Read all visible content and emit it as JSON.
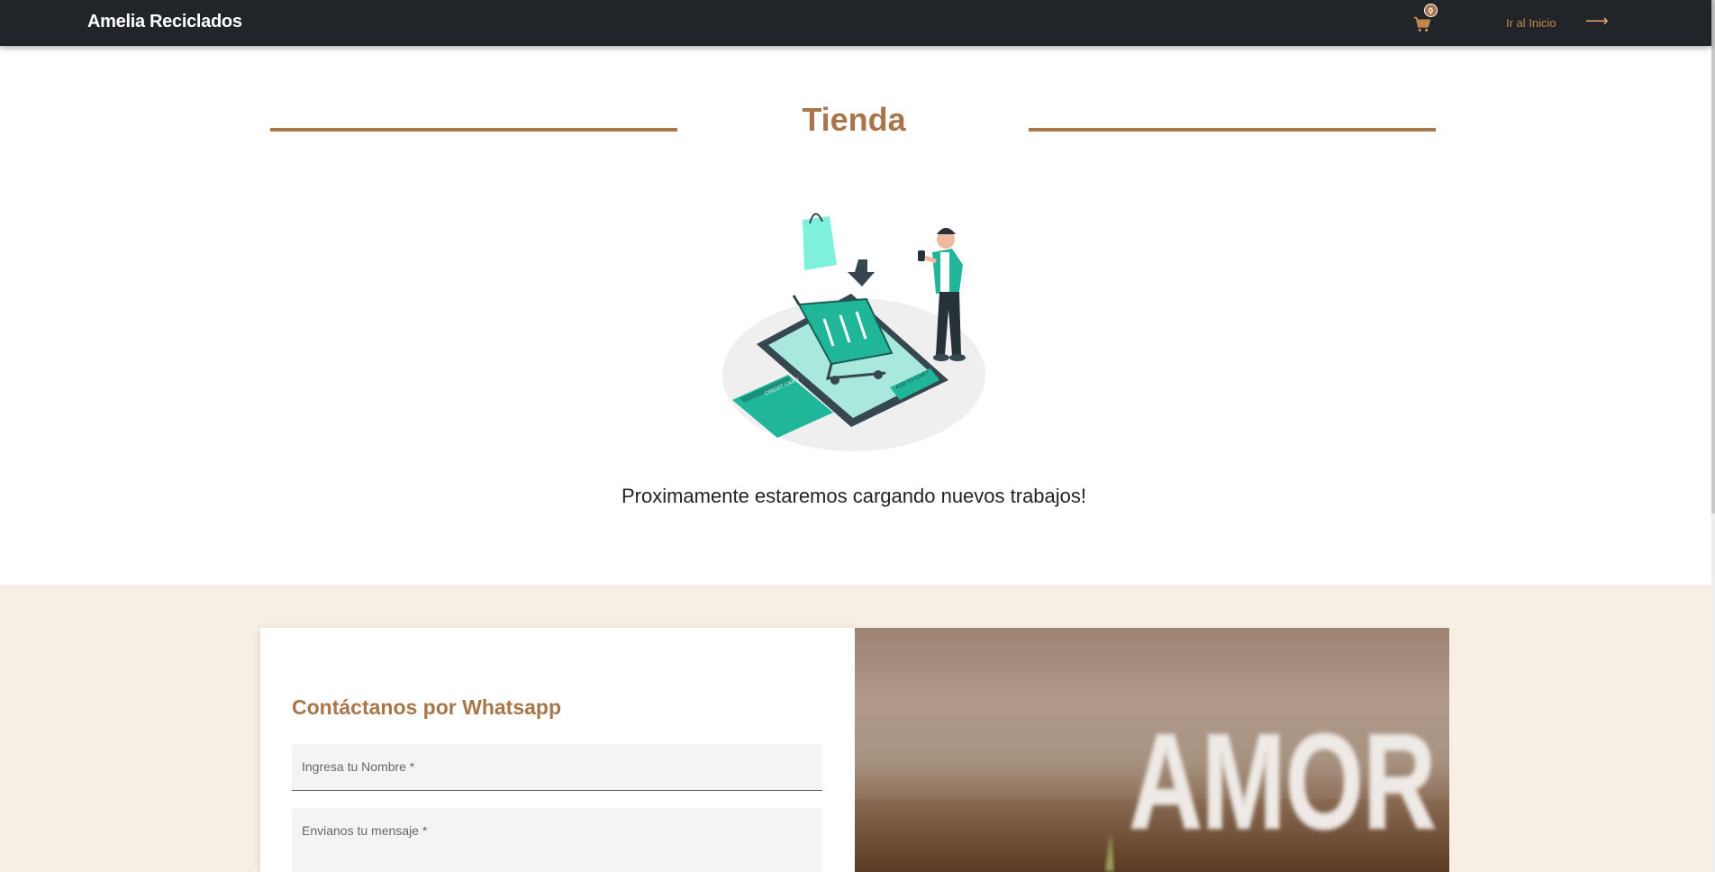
{
  "navbar": {
    "brand": "Amelia Reciclados",
    "cart_count": "0",
    "home_link": "Ir al Inicio",
    "home_arrow": "⟶"
  },
  "shop": {
    "title": "Tienda",
    "message": "Proximamente estaremos cargando nuevos trabajos!",
    "illustration_texts": [
      "CREDIT CARD",
      "ADD TO CART"
    ]
  },
  "contact": {
    "title": "Contáctanos por Whatsapp",
    "name_placeholder": "Ingresa tu Nombre *",
    "message_placeholder": "Envianos tu mensaje *"
  },
  "photo": {
    "sign_text": "AMOR"
  },
  "colors": {
    "navbar_bg": "#212529",
    "accent": "#a8764a",
    "section_bg": "#f7efe3",
    "teal": "#20b69a"
  },
  "icons": [
    "cart-icon",
    "arrow-right-icon"
  ]
}
